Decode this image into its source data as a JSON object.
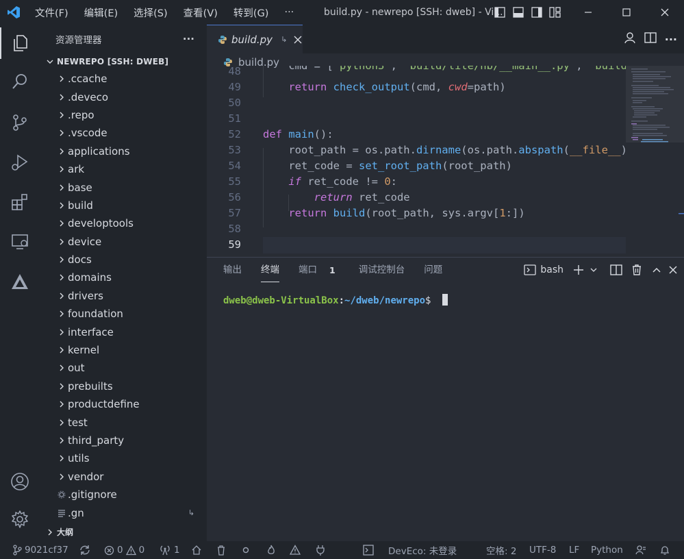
{
  "titlebar": {
    "menu": [
      "文件(F)",
      "编辑(E)",
      "选择(S)",
      "查看(V)",
      "转到(G)",
      "···"
    ],
    "title": "build.py - newrepo [SSH: dweb] - Vi...",
    "icons": [
      "vscode-logo-icon",
      "toggle-sidebar-icon",
      "toggle-panel-icon",
      "toggle-secondary-sidebar-icon",
      "customize-layout-icon",
      "minimize-icon",
      "maximize-icon",
      "close-icon"
    ]
  },
  "activity_bar": {
    "icons": [
      "explorer-icon",
      "search-icon",
      "source-control-icon",
      "run-debug-icon",
      "extensions-icon",
      "remote-explorer-icon",
      "deveco-icon",
      "accounts-icon",
      "settings-gear-icon"
    ]
  },
  "sidebar": {
    "title": "资源管理器",
    "more": "···",
    "root": "NEWREPO [SSH: DWEB]",
    "items": [
      {
        "label": ".ccache",
        "type": "folder"
      },
      {
        "label": ".deveco",
        "type": "folder"
      },
      {
        "label": ".repo",
        "type": "folder"
      },
      {
        "label": ".vscode",
        "type": "folder"
      },
      {
        "label": "applications",
        "type": "folder"
      },
      {
        "label": "ark",
        "type": "folder"
      },
      {
        "label": "base",
        "type": "folder"
      },
      {
        "label": "build",
        "type": "folder"
      },
      {
        "label": "developtools",
        "type": "folder"
      },
      {
        "label": "device",
        "type": "folder"
      },
      {
        "label": "docs",
        "type": "folder"
      },
      {
        "label": "domains",
        "type": "folder"
      },
      {
        "label": "drivers",
        "type": "folder"
      },
      {
        "label": "foundation",
        "type": "folder"
      },
      {
        "label": "interface",
        "type": "folder"
      },
      {
        "label": "kernel",
        "type": "folder"
      },
      {
        "label": "out",
        "type": "folder"
      },
      {
        "label": "prebuilts",
        "type": "folder"
      },
      {
        "label": "productdefine",
        "type": "folder"
      },
      {
        "label": "test",
        "type": "folder"
      },
      {
        "label": "third_party",
        "type": "folder"
      },
      {
        "label": "utils",
        "type": "folder"
      },
      {
        "label": "vendor",
        "type": "folder"
      },
      {
        "label": ".gitignore",
        "type": "file-gear"
      },
      {
        "label": ".gn",
        "type": "file-lines"
      }
    ],
    "outline": "大纲"
  },
  "editor": {
    "tab_label": "build.py",
    "breadcrumb": "build.py",
    "line_numbers": [
      "48",
      "49",
      "50",
      "51",
      "52",
      "53",
      "54",
      "55",
      "56",
      "57",
      "58",
      "59"
    ]
  },
  "panel": {
    "tabs": [
      "输出",
      "终端",
      "端口",
      "调试控制台",
      "问题"
    ],
    "ports_count": "1",
    "shell": "bash",
    "prompt_user": "dweb@dweb-VirtualBox",
    "prompt_sep": ":",
    "prompt_path": "~/dweb/newrepo",
    "prompt_end": "$"
  },
  "statusbar": {
    "branch": "9021cf37",
    "errors": "0",
    "warnings": "0",
    "ports": "1",
    "deveco": "DevEco: 未登录",
    "spaces": "空格: 2",
    "encoding": "UTF-8",
    "eol": "LF",
    "language": "Python"
  }
}
